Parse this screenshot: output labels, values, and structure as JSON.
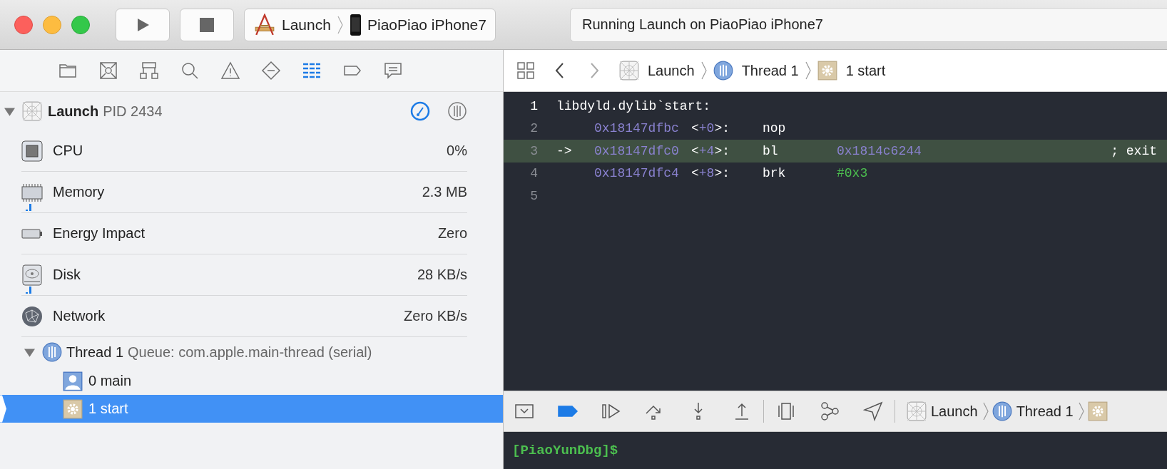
{
  "toolbar": {
    "scheme": {
      "app": "Launch",
      "device": "PiaoPiao iPhone7"
    },
    "activity": "Running Launch on PiaoPiao iPhone7"
  },
  "navigator_tabs": [
    {
      "kind": "project",
      "selected": false
    },
    {
      "kind": "symbol",
      "selected": false
    },
    {
      "kind": "hierarchy",
      "selected": false
    },
    {
      "kind": "search",
      "selected": false
    },
    {
      "kind": "issue",
      "selected": false
    },
    {
      "kind": "test",
      "selected": false
    },
    {
      "kind": "debug",
      "selected": true
    },
    {
      "kind": "breakpoint",
      "selected": false
    },
    {
      "kind": "report",
      "selected": false
    }
  ],
  "process": {
    "name": "Launch",
    "pid": "PID 2434",
    "expanded": true
  },
  "gauges": [
    {
      "kind": "cpu",
      "label": "CPU",
      "value": "0%",
      "graph": false
    },
    {
      "kind": "memory",
      "label": "Memory",
      "value": "2.3 MB",
      "graph": true
    },
    {
      "kind": "energy",
      "label": "Energy Impact",
      "value": "Zero",
      "graph": false
    },
    {
      "kind": "disk",
      "label": "Disk",
      "value": "28 KB/s",
      "graph": true
    },
    {
      "kind": "network",
      "label": "Network",
      "value": "Zero KB/s",
      "graph": false
    }
  ],
  "thread": {
    "label": "Thread 1",
    "queue": "Queue: com.apple.main-thread (serial)",
    "expanded": true,
    "frames": [
      {
        "kind": "user",
        "label": "0 main",
        "selected": false
      },
      {
        "kind": "system",
        "label": "1 start",
        "selected": true
      }
    ]
  },
  "jump_bar": [
    {
      "kind": "app",
      "label": "Launch"
    },
    {
      "kind": "thread",
      "label": "Thread 1"
    },
    {
      "kind": "frame",
      "label": "1 start"
    }
  ],
  "code": [
    {
      "number": "1",
      "current": false,
      "kind": "label",
      "text": "libdyld.dylib`start:"
    },
    {
      "number": "2",
      "current": false,
      "kind": "instruction",
      "address": "0x18147dfbc",
      "offset": "<+0>:",
      "mnemonic": "nop"
    },
    {
      "number": "3",
      "current": true,
      "kind": "instruction",
      "marker": "->",
      "address": "0x18147dfc0",
      "offset": "<+4>:",
      "mnemonic": "bl",
      "operand": "0x1814c6244",
      "literal": false,
      "comment": "; exit"
    },
    {
      "number": "4",
      "current": false,
      "kind": "instruction",
      "address": "0x18147dfc4",
      "offset": "<+8>:",
      "mnemonic": "brk",
      "operand": "#0x3",
      "literal": true
    },
    {
      "number": "5",
      "current": false,
      "kind": "empty"
    }
  ],
  "debug_bar": {
    "button_groups": [
      [
        {
          "kind": "console",
          "active": false
        },
        {
          "kind": "breakpoints",
          "active": true
        },
        {
          "kind": "continue",
          "active": false
        },
        {
          "kind": "step-over",
          "active": false
        },
        {
          "kind": "step-into",
          "active": false
        },
        {
          "kind": "step-out",
          "active": false
        }
      ],
      [
        {
          "kind": "view-debugger",
          "active": false
        },
        {
          "kind": "memory-graph",
          "active": false
        },
        {
          "kind": "location",
          "active": false
        }
      ]
    ],
    "jump_bar": [
      {
        "kind": "app",
        "label": "Launch"
      },
      {
        "kind": "thread",
        "label": "Thread 1"
      },
      {
        "kind": "frame"
      }
    ]
  },
  "console": {
    "prompt": "[PiaoYunDbg]$"
  }
}
